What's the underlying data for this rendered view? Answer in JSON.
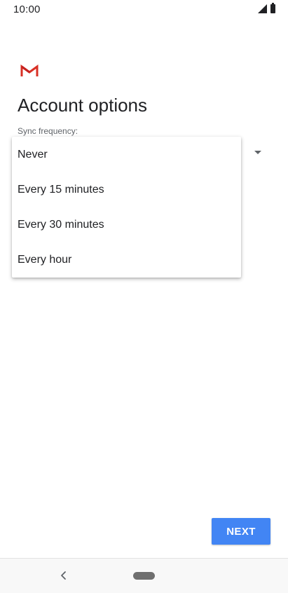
{
  "status_bar": {
    "time": "10:00",
    "icons": [
      "signal-icon",
      "battery-icon"
    ]
  },
  "app": {
    "logo_icon": "gmail-logo-icon",
    "brand_color": "#d93025"
  },
  "page": {
    "title": "Account options",
    "sync_label": "Sync frequency:"
  },
  "dropdown": {
    "options": [
      {
        "label": "Never"
      },
      {
        "label": "Every 15 minutes"
      },
      {
        "label": "Every 30 minutes"
      },
      {
        "label": "Every hour"
      }
    ]
  },
  "footer": {
    "next_label": "NEXT",
    "accent_color": "#4285f4"
  },
  "nav_bar": {
    "icons": [
      "back-icon",
      "home-pill-icon"
    ]
  }
}
